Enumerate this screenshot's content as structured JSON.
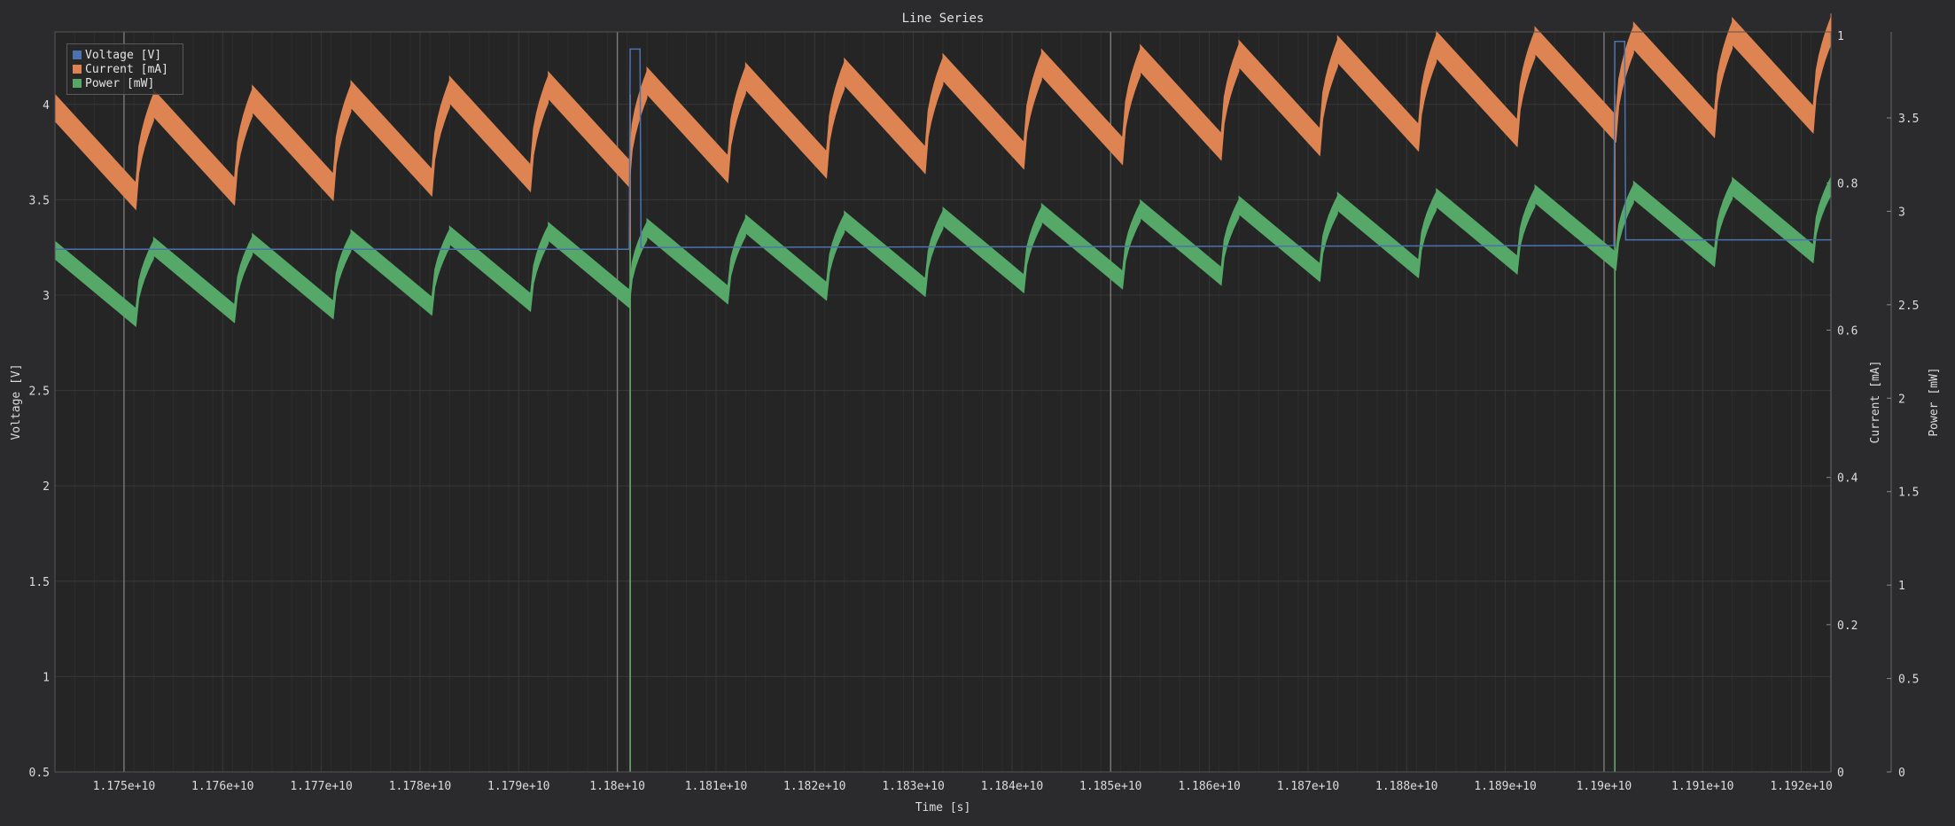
{
  "chart_data": {
    "type": "line",
    "title": "Line Series",
    "xlabel": "Time [s]",
    "x_ticks": [
      "1.175e+10",
      "1.176e+10",
      "1.177e+10",
      "1.178e+10",
      "1.179e+10",
      "1.18e+10",
      "1.181e+10",
      "1.182e+10",
      "1.183e+10",
      "1.184e+10",
      "1.185e+10",
      "1.186e+10",
      "1.187e+10",
      "1.188e+10",
      "1.189e+10",
      "1.19e+10",
      "1.191e+10",
      "1.192e+10"
    ],
    "xlim": [
      11743000000,
      11923000000
    ],
    "axes": [
      {
        "label": "Voltage [V]",
        "side": "left",
        "ylim": [
          0.5,
          4.38
        ],
        "ticks": [
          "0.5",
          "1",
          "1.5",
          "2",
          "2.5",
          "3",
          "3.5",
          "4"
        ]
      },
      {
        "label": "Current [mA]",
        "side": "right",
        "ylim": [
          0,
          1.005
        ],
        "ticks": [
          "0",
          "0.2",
          "0.4",
          "0.6",
          "0.8",
          "1"
        ]
      },
      {
        "label": "Power [mW]",
        "side": "right",
        "ylim": [
          0,
          3.96
        ],
        "ticks": [
          "0",
          "0.5",
          "1",
          "1.5",
          "2",
          "2.5",
          "3",
          "3.5"
        ]
      }
    ],
    "series": [
      {
        "name": "Voltage [V]",
        "color": "#4c72b0",
        "axis": 0,
        "points": [
          [
            11743000000,
            3.24
          ],
          [
            11800000000,
            3.24
          ],
          [
            11801200000,
            3.24
          ],
          [
            11801300000,
            4.29
          ],
          [
            11802300000,
            4.29
          ],
          [
            11802400000,
            3.25
          ],
          [
            11901000000,
            3.26
          ],
          [
            11901100000,
            4.33
          ],
          [
            11902100000,
            4.33
          ],
          [
            11902200000,
            3.29
          ],
          [
            11923000000,
            3.29
          ]
        ]
      },
      {
        "name": "Current [mA]",
        "color": "#dd8452",
        "axis": 1,
        "sawtooth": {
          "period": 10000000,
          "first_peak": 11743000000,
          "start_top": 0.92,
          "end_top": 1.03,
          "drop": 0.12,
          "band": 0.036
        },
        "spikes": [
          [
            11801300000,
            0
          ],
          [
            11901100000,
            0
          ]
        ]
      },
      {
        "name": "Power [mW]",
        "color": "#55a868",
        "axis": 2,
        "sawtooth": {
          "period": 10000000,
          "first_peak": 11743000000,
          "start_top": 2.84,
          "end_top": 3.2,
          "drop": 0.36,
          "band": 0.095
        },
        "spikes": [
          [
            11801300000,
            0
          ],
          [
            11901100000,
            0
          ]
        ]
      }
    ],
    "vertical_markers": [
      11750000000,
      11800000000,
      11850000000,
      11900000000
    ],
    "grid": true,
    "legend_position": "top-left"
  }
}
